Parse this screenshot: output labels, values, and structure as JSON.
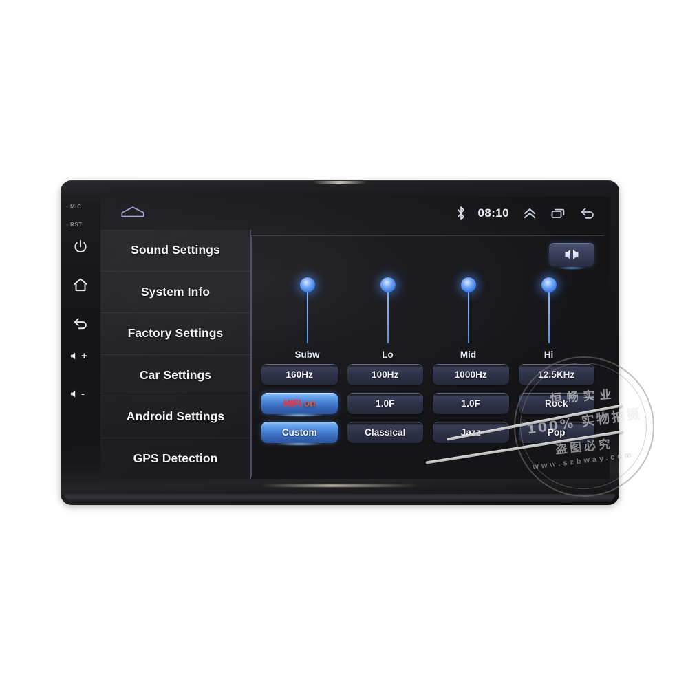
{
  "device": {
    "bezel_labels": [
      {
        "name": "mic-label",
        "text": "MIC"
      },
      {
        "name": "rst-label",
        "text": "RST"
      }
    ],
    "hard_buttons": [
      {
        "name": "power-button",
        "icon": "power-icon",
        "label": "Power"
      },
      {
        "name": "home-hard-button",
        "icon": "home-icon",
        "label": "Home"
      },
      {
        "name": "back-hard-button",
        "icon": "back-arrow-icon",
        "label": "Back"
      },
      {
        "name": "volume-up-button",
        "icon": "volume-up-icon",
        "label": "+"
      },
      {
        "name": "volume-down-button",
        "icon": "volume-down-icon",
        "label": "-"
      }
    ]
  },
  "statusbar": {
    "home_icon": "home-outline-icon",
    "bluetooth_icon": "bluetooth-icon",
    "time": "08:10",
    "expand_icon": "double-chevron-up-icon",
    "recents_icon": "recent-apps-icon",
    "back_icon": "back-arrow-icon"
  },
  "sidebar": {
    "items": [
      {
        "label": "Sound Settings",
        "selected": true
      },
      {
        "label": "System Info",
        "selected": false
      },
      {
        "label": "Factory Settings",
        "selected": false
      },
      {
        "label": "Car Settings",
        "selected": false
      },
      {
        "label": "Android Settings",
        "selected": false
      },
      {
        "label": "GPS Detection",
        "selected": false
      }
    ]
  },
  "content": {
    "balance_button": {
      "name": "balance-fader-button",
      "icon": "dual-speaker-icon"
    },
    "sliders": [
      {
        "label": "Subw",
        "value": 100
      },
      {
        "label": "Lo",
        "value": 100
      },
      {
        "label": "Mid",
        "value": 100
      },
      {
        "label": "Hi",
        "value": 100
      }
    ],
    "buttons": [
      {
        "label": "160Hz",
        "active": false
      },
      {
        "label": "100Hz",
        "active": false
      },
      {
        "label": "1000Hz",
        "active": false
      },
      {
        "label": "12.5KHz",
        "active": false
      },
      {
        "label": "HIFI on",
        "active": true,
        "style": "hifi",
        "main": "HIFI",
        "sub": "on"
      },
      {
        "label": "1.0F",
        "active": false
      },
      {
        "label": "1.0F",
        "active": false
      },
      {
        "label": "Rock",
        "active": false
      },
      {
        "label": "Custom",
        "active": true
      },
      {
        "label": "Classical",
        "active": false
      },
      {
        "label": "Jazz",
        "active": false
      },
      {
        "label": "Pop",
        "active": false
      }
    ]
  },
  "watermark": {
    "company_cn": "恒畅实业",
    "claim_cn": "100% 实物拍摄",
    "copyright_cn": "盗图必究",
    "url": "www.szbway.com"
  },
  "colors": {
    "accent_blue": "#4a85d8",
    "slider_blue": "#6aa8f5",
    "hifi_red": "#ff2d2d",
    "panel_border": "#7882a5",
    "screen_bg": "#1d1d21"
  }
}
